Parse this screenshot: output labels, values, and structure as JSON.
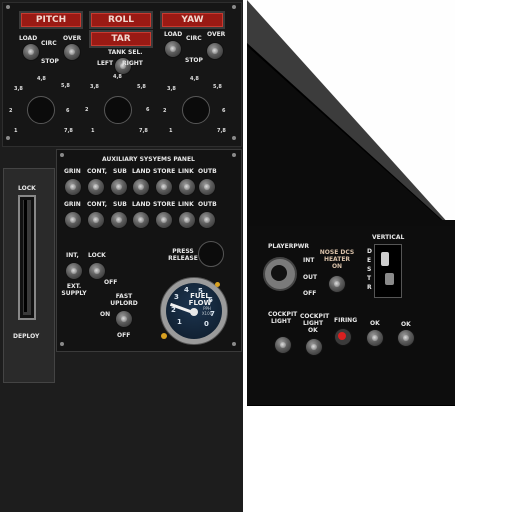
{
  "left_panel": {
    "axis_buttons": [
      "PITCH",
      "ROLL",
      "YAW"
    ],
    "tar_button": "TAR",
    "load_label": "LOAD",
    "circ_label": "CIRC",
    "over_label": "OVER",
    "stop_label": "STOP",
    "tank_sel_label": "TANK SEL.",
    "left_label": "LEFT",
    "right_label": "RIGHT",
    "dial_scale": [
      "4,8",
      "3,8",
      "5,8",
      "2",
      "6",
      "1",
      "7,8"
    ]
  },
  "aux_panel": {
    "title": "AUXILIARY SYSYEMS PANEL",
    "switch_labels": [
      "GRIN",
      "CONT,",
      "SUB",
      "LAND",
      "STORE",
      "LINK",
      "OUTB"
    ],
    "int_label": "INT,",
    "lock_label": "LOCK",
    "ext_supply_label": "EXT. SUPPLY",
    "off_label": "OFF",
    "press_release_label": "PRESS RELEASE",
    "fast_uplord_label": "FAST UPLORD",
    "on_label": "ON",
    "gauge": {
      "label": "FUEL FLOW",
      "unit": "PPH X100",
      "ticks": [
        "1",
        "2",
        "3",
        "4",
        "5",
        "6",
        "7",
        "0"
      ]
    }
  },
  "lever_panel": {
    "lock_label": "LOCK",
    "deploy_label": "DEPLOY"
  },
  "right_panel": {
    "playerpwr_label": "PLAYERPWR",
    "nose_label": "NOSE DCS HEATER ON",
    "vertical_label": "VERTICAL",
    "vertical_letters": [
      "D",
      "E",
      "S",
      "T",
      "R"
    ],
    "int_label": "INT",
    "out_label": "OUT",
    "off_label": "OFF",
    "cockpit_light_label": "COCKPIT LIGHT",
    "ok_label": "OK",
    "firing_label": "FIRING"
  },
  "colors": {
    "panel": "#1b1b1b",
    "button_red": "#9a1a14",
    "lamp_red": "#d82020",
    "gauge_blue": "#16283c"
  }
}
